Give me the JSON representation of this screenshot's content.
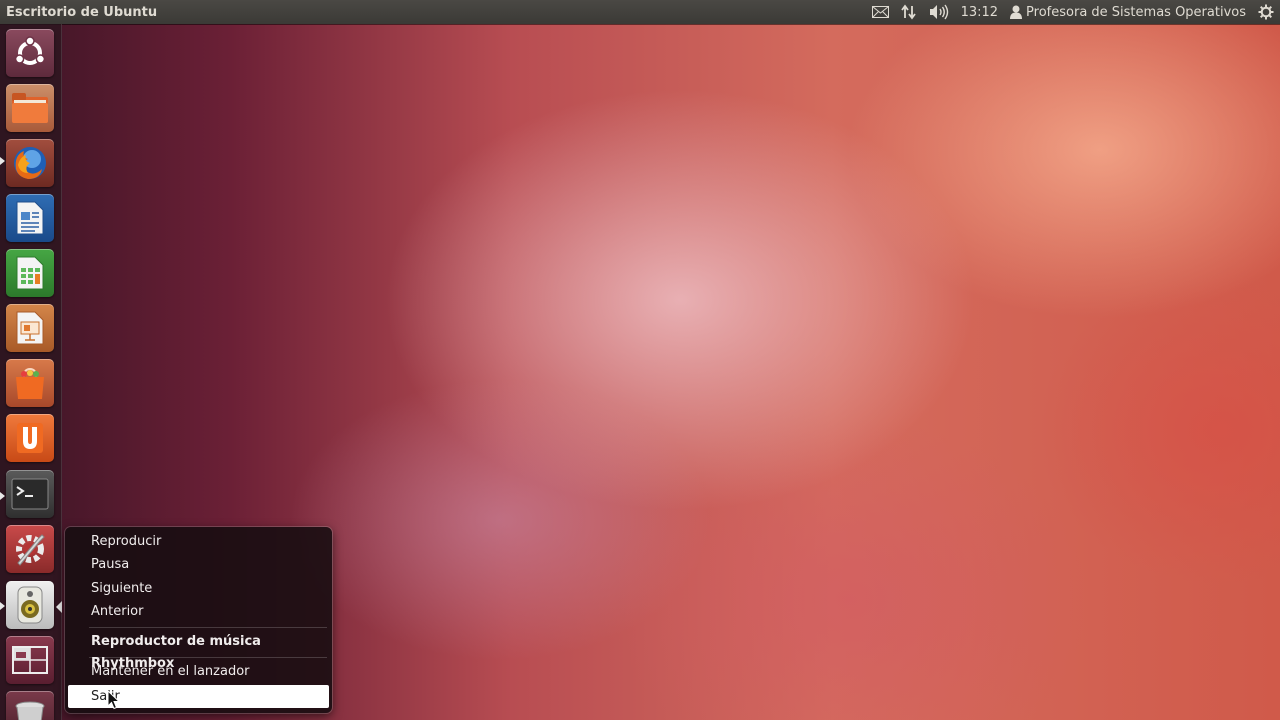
{
  "top_panel": {
    "title": "Escritorio de Ubuntu",
    "clock": "13:12",
    "user": "Profesora de Sistemas Operativos",
    "indicators": [
      "mail-icon",
      "network-icon",
      "volume-icon",
      "clock",
      "user-icon",
      "session-gear-icon"
    ]
  },
  "launcher": {
    "items": [
      {
        "name": "dash-home",
        "icon": "ubuntu-logo-icon",
        "running": false
      },
      {
        "name": "files",
        "icon": "folder-icon",
        "running": false
      },
      {
        "name": "firefox",
        "icon": "firefox-icon",
        "running": true
      },
      {
        "name": "libreoffice-writer",
        "icon": "writer-icon",
        "running": false
      },
      {
        "name": "libreoffice-calc",
        "icon": "calc-icon",
        "running": false
      },
      {
        "name": "libreoffice-impress",
        "icon": "impress-icon",
        "running": false
      },
      {
        "name": "software-center",
        "icon": "shopping-bag-icon",
        "running": false
      },
      {
        "name": "ubuntu-one",
        "icon": "ubuntu-one-icon",
        "running": false
      },
      {
        "name": "terminal",
        "icon": "terminal-icon",
        "running": true
      },
      {
        "name": "system-settings",
        "icon": "settings-icon",
        "running": false
      },
      {
        "name": "rhythmbox",
        "icon": "speaker-icon",
        "running": true
      },
      {
        "name": "workspace-switcher",
        "icon": "workspaces-icon",
        "running": false
      },
      {
        "name": "trash",
        "icon": "trash-icon",
        "running": false
      }
    ]
  },
  "quicklist": {
    "items": [
      "Reproducir",
      "Pausa",
      "Siguiente",
      "Anterior"
    ],
    "app_title": "Reproductor de música Rhythmbox",
    "keep_in_launcher": "Mantener en el lanzador",
    "quit": "Salir"
  }
}
